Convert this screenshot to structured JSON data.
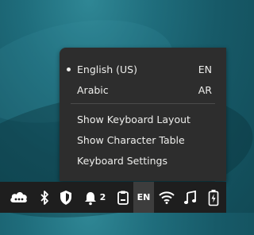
{
  "keyboard_menu": {
    "items": [
      {
        "label": "English (US)",
        "code": "EN",
        "selected": true
      },
      {
        "label": "Arabic",
        "code": "AR",
        "selected": false
      }
    ],
    "actions": [
      {
        "label": "Show Keyboard Layout"
      },
      {
        "label": "Show Character Table"
      },
      {
        "label": "Keyboard Settings"
      }
    ]
  },
  "panel": {
    "icons": [
      "cloud-chat-icon",
      "bluetooth-icon",
      "shield-icon",
      "notification-bell-icon",
      "clipboard-icon",
      "keyboard-layout-indicator",
      "wifi-icon",
      "music-icon",
      "battery-icon"
    ],
    "notification_count": "2",
    "keyboard_indicator": "EN"
  },
  "colors": {
    "panel_bg": "#1e1e1e",
    "menu_bg": "#2d2d2d",
    "active_indicator_bg": "#3d3d3d"
  }
}
